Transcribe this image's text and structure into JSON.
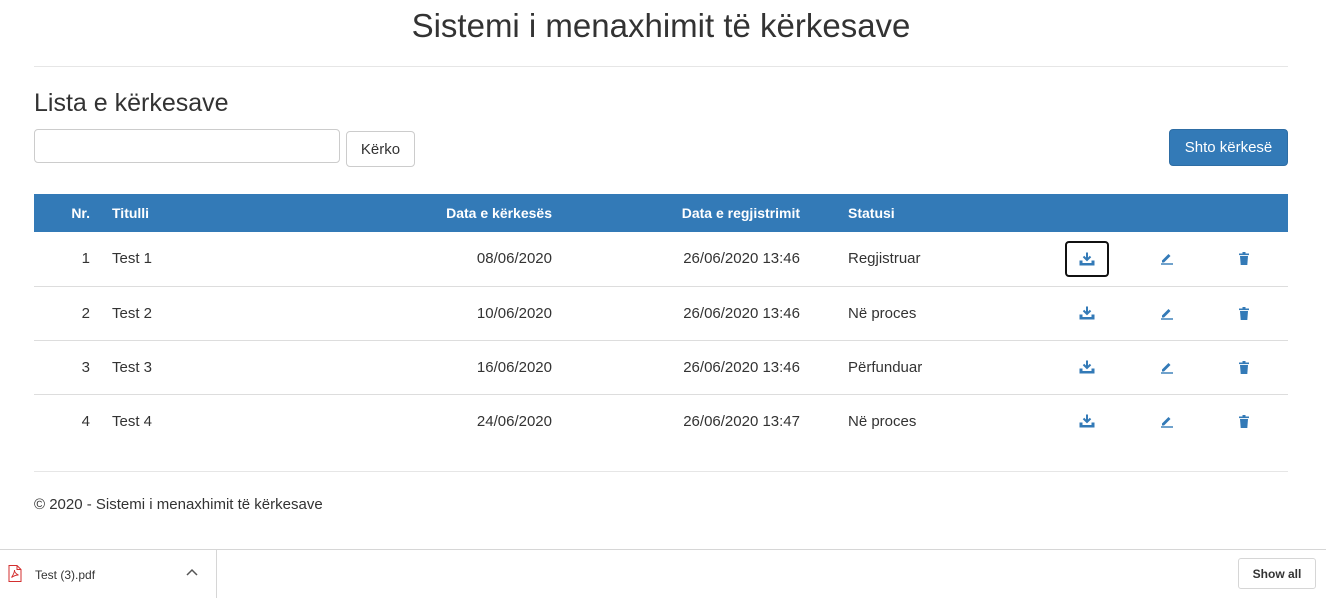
{
  "header": {
    "title": "Sistemi i menaxhimit të kërkesave"
  },
  "list": {
    "title": "Lista e kërkesave",
    "search": {
      "value": "",
      "placeholder": "",
      "button_label": "Kërko"
    },
    "add_button_label": "Shto kërkesë",
    "columns": [
      "Nr.",
      "Titulli",
      "Data e kërkesës",
      "Data e regjistrimit",
      "Statusi"
    ],
    "rows": [
      {
        "nr": "1",
        "title": "Test 1",
        "request_date": "08/06/2020",
        "registered": "26/06/2020 13:46",
        "status": "Regjistruar"
      },
      {
        "nr": "2",
        "title": "Test 2",
        "request_date": "10/06/2020",
        "registered": "26/06/2020 13:46",
        "status": "Në proces"
      },
      {
        "nr": "3",
        "title": "Test 3",
        "request_date": "16/06/2020",
        "registered": "26/06/2020 13:46",
        "status": "Përfunduar"
      },
      {
        "nr": "4",
        "title": "Test 4",
        "request_date": "24/06/2020",
        "registered": "26/06/2020 13:47",
        "status": "Në proces"
      }
    ],
    "row_actions": [
      "download-icon",
      "pencil-icon",
      "trash-icon"
    ]
  },
  "footer": {
    "copyright": "© 2020 - Sistemi i menaxhimit të kërkesave"
  },
  "download_bar": {
    "file_name": "Test (3).pdf",
    "file_icon": "pdf-file-icon",
    "chevron_icon": "chevron-up-icon",
    "show_all_label": "Show all"
  },
  "colors": {
    "primary": "#337ab7",
    "primary_border": "#2e6da4",
    "text": "#333333",
    "border": "#dddddd",
    "pdf_red": "#d32f2f"
  }
}
